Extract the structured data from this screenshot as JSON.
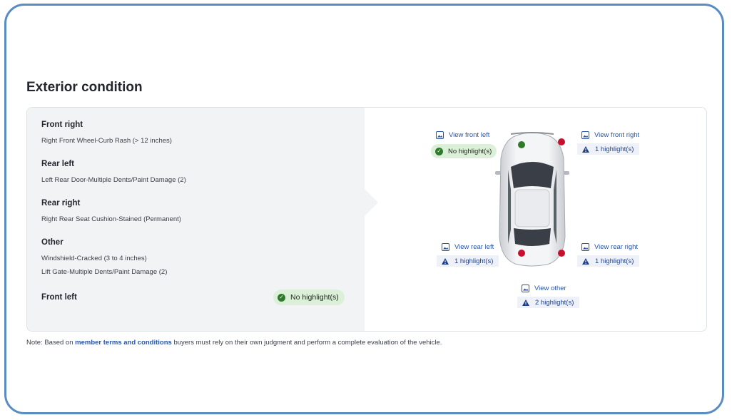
{
  "section": {
    "title": "Exterior condition"
  },
  "list": {
    "front_right": {
      "heading": "Front right",
      "items": [
        "Right Front Wheel-Curb Rash (> 12 inches)"
      ]
    },
    "rear_left": {
      "heading": "Rear left",
      "items": [
        "Left Rear Door-Multiple Dents/Paint Damage (2)"
      ]
    },
    "rear_right": {
      "heading": "Rear right",
      "items": [
        "Right Rear Seat Cushion-Stained (Permanent)"
      ]
    },
    "other": {
      "heading": "Other",
      "items": [
        "Windshield-Cracked (3 to 4 inches)",
        "Lift Gate-Multiple Dents/Paint Damage (2)"
      ]
    },
    "front_left": {
      "heading": "Front left",
      "badge": "No highlight(s)"
    }
  },
  "diagram": {
    "front_left": {
      "link": "View front left",
      "badge": "No highlight(s)",
      "status": "ok"
    },
    "front_right": {
      "link": "View front right",
      "badge": "1 highlight(s)",
      "status": "warn"
    },
    "rear_left": {
      "link": "View rear left",
      "badge": "1 highlight(s)",
      "status": "warn"
    },
    "rear_right": {
      "link": "View rear right",
      "badge": "1 highlight(s)",
      "status": "warn"
    },
    "other": {
      "link": "View other",
      "badge": "2 highlight(s)",
      "status": "warn"
    }
  },
  "note": {
    "prefix": "Note: Based on ",
    "link": "member terms and conditions",
    "suffix": " buyers must rely on their own judgment and perform a complete evaluation of the vehicle."
  },
  "colors": {
    "ok": "#2f7a2b",
    "damage": "#c8102e",
    "link": "#2a55a6",
    "warn": "#1f3f86"
  },
  "icons": {
    "view": "image-icon",
    "ok": "check-circle-icon",
    "warn": "warning-icon"
  }
}
